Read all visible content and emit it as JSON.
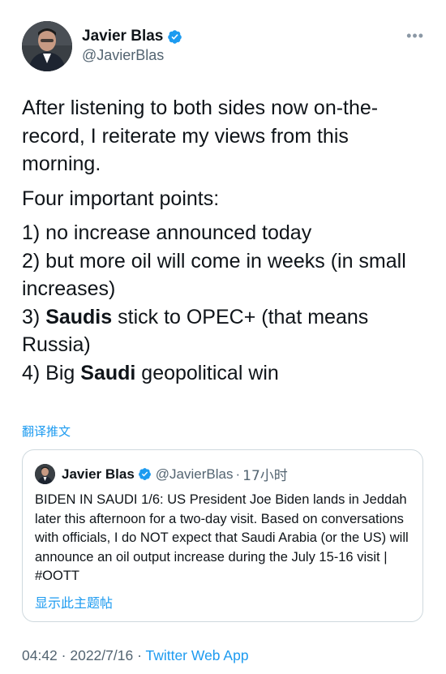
{
  "author": {
    "name": "Javier Blas",
    "handle": "@JavierBlas",
    "verified_icon": "verified-badge-icon",
    "more_label": "•••"
  },
  "tweet": {
    "paragraph1": "After listening to both sides now on-the-record, I reiterate my views from this morning.",
    "paragraph2": "Four important points:",
    "point1": "1) no increase announced today",
    "point2": "2) but more oil will come in weeks (in small increases)",
    "point3_prefix": "3) ",
    "point3_bold": "Saudis",
    "point3_suffix": " stick to OPEC+ (that means Russia)",
    "point4_prefix": "4) Big ",
    "point4_bold": "Saudi",
    "point4_suffix": " geopolitical win"
  },
  "translate_label": "翻译推文",
  "quoted": {
    "name": "Javier Blas",
    "handle": "@JavierBlas",
    "separator": "·",
    "time": "17小时",
    "text": "BIDEN IN SAUDI 1/6: US President Joe Biden lands in Jeddah later this afternoon for a two-day visit. Based on conversations with officials, I do NOT expect that Saudi Arabia (or the US) will announce an oil output increase during the July 15-16 visit | #OOTT",
    "show_thread_label": "显示此主题帖"
  },
  "meta": {
    "time": "04:42",
    "separator1": " · ",
    "date": "2022/7/16",
    "separator2": " · ",
    "source": "Twitter Web App"
  },
  "colors": {
    "accent": "#1d9bf0",
    "secondary_text": "#536471",
    "border": "#cfd9de"
  }
}
